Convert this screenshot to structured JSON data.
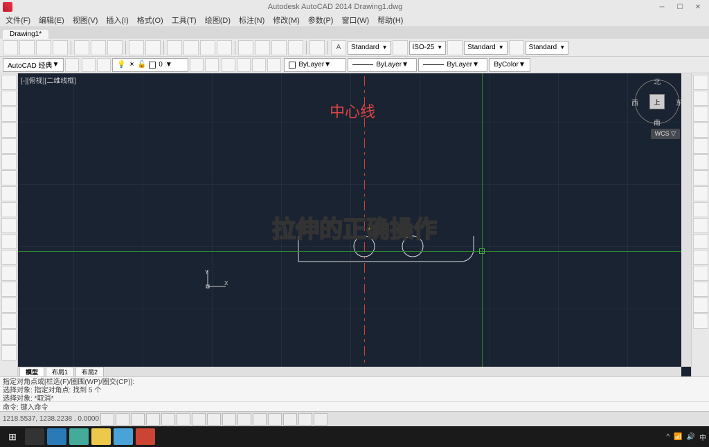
{
  "app": {
    "title": "Autodesk AutoCAD 2014   Drawing1.dwg"
  },
  "menu": {
    "items": [
      "文件(F)",
      "编辑(E)",
      "视图(V)",
      "插入(I)",
      "格式(O)",
      "工具(T)",
      "绘图(D)",
      "标注(N)",
      "修改(M)",
      "参数(P)",
      "窗口(W)",
      "帮助(H)"
    ]
  },
  "tabs": {
    "doc": "Drawing1*"
  },
  "toolbar_top": {
    "styles": [
      "Standard",
      "ISO-25",
      "Standard",
      "Standard"
    ]
  },
  "workspace": {
    "selector": "AutoCAD 经典",
    "layer_name": "0",
    "props": [
      "ByLayer",
      "ByLayer",
      "ByLayer",
      "ByColor"
    ]
  },
  "viewport": {
    "label": "[-][俯视][二维线框]",
    "navcube": {
      "top": "上",
      "n": "北",
      "s": "南",
      "e": "东",
      "w": "西"
    },
    "wcs": "WCS ▽"
  },
  "annotations": {
    "centerline": "中心线",
    "overlay": "拉伸的正确操作"
  },
  "model_tabs": {
    "model": "模型",
    "layout1": "布局1",
    "layout2": "布局2"
  },
  "command": {
    "history1": "指定对角点或[栏选(F)/圈围(WP)/圈交(CP)]:",
    "history2": "选择对象: 指定对角点: 找到 5 个",
    "history3": "选择对象: *取消*",
    "prompt": "命令: 键入命令"
  },
  "status": {
    "coords": "1218.5537, 1238.2238 , 0.0000"
  },
  "taskbar": {
    "icons": [
      "start",
      "search",
      "cortana",
      "browser",
      "folder",
      "store",
      "autocad"
    ]
  }
}
